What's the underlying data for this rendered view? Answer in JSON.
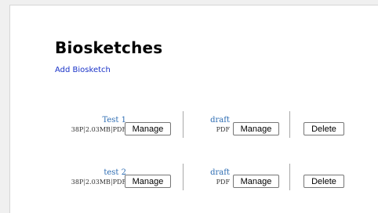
{
  "page": {
    "title": "Biosketches",
    "add_link": "Add Biosketch"
  },
  "rows": [
    {
      "file": {
        "name": "Test 1",
        "pages": "38P",
        "size": "2.03MB",
        "type": "PDF"
      },
      "manage_label": "Manage",
      "draft": {
        "name": "draft",
        "type": "PDF"
      },
      "draft_manage_label": "Manage",
      "delete_label": "Delete"
    },
    {
      "file": {
        "name": "test 2",
        "pages": "38P",
        "size": "2.03MB",
        "type": "PDF"
      },
      "manage_label": "Manage",
      "draft": {
        "name": "draft",
        "type": "PDF"
      },
      "draft_manage_label": "Manage",
      "delete_label": "Delete"
    }
  ],
  "separator": "|",
  "colors": {
    "link": "#1a33c8",
    "file_name": "#2e6db3",
    "background": "#f0f0f0",
    "panel": "#ffffff"
  }
}
